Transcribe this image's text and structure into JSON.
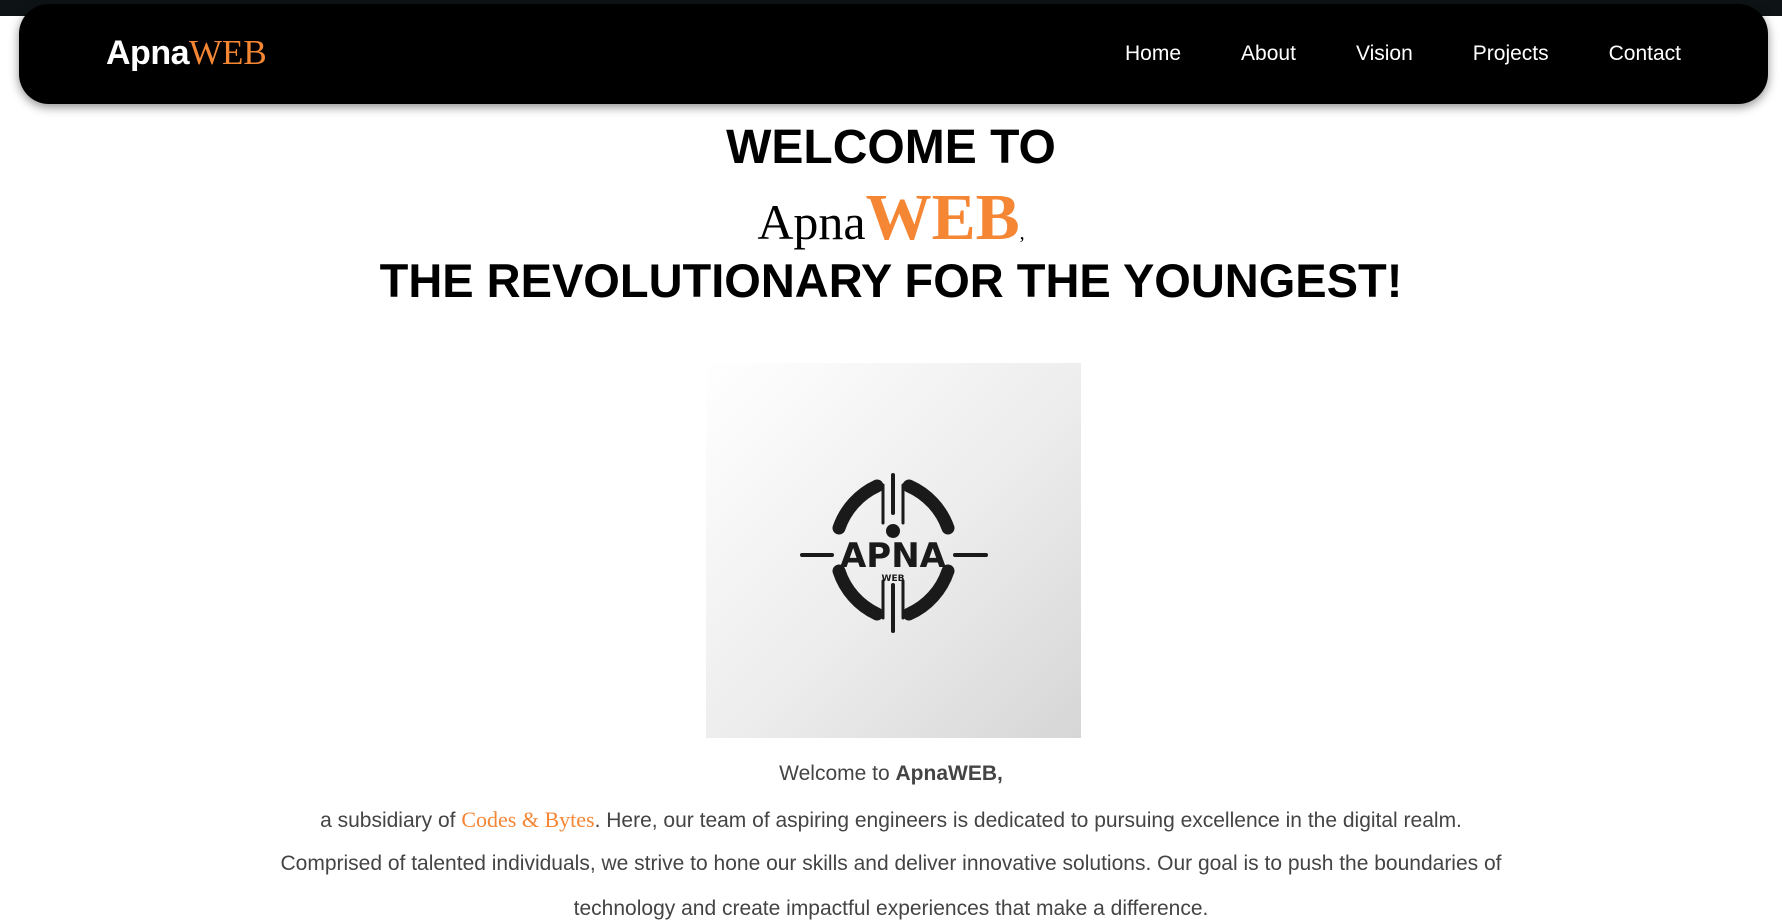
{
  "nav": {
    "brand_apna": "Apna",
    "brand_web": "WEB",
    "links": [
      "Home",
      "About",
      "Vision",
      "Projects",
      "Contact"
    ]
  },
  "hero": {
    "line1": "WELCOME TO",
    "apna": "Apna",
    "web": "WEB",
    "comma": ",",
    "line3": "THE REVOLUTIONARY FOR THE YOUNGEST!"
  },
  "logo": {
    "icon": "apna-web-crosshair-logo",
    "text_main": "APNA",
    "text_sub": "WEB"
  },
  "intro": {
    "welcome_prefix": "Welcome to ",
    "welcome_brand": "ApnaWEB,",
    "subsidiary_prefix": "a subsidiary of ",
    "subsidiary_link": "Codes & Bytes",
    "subsidiary_suffix": ". Here, our team of aspiring engineers is dedicated to pursuing excellence in the digital realm.",
    "line3": "Comprised of talented individuals, we strive to hone our skills and deliver innovative solutions. Our goal is to push the boundaries of",
    "line4": "technology and create impactful experiences that make a difference."
  },
  "colors": {
    "accent": "#f58634",
    "navbar_bg": "#000000",
    "body_text": "#444444"
  }
}
